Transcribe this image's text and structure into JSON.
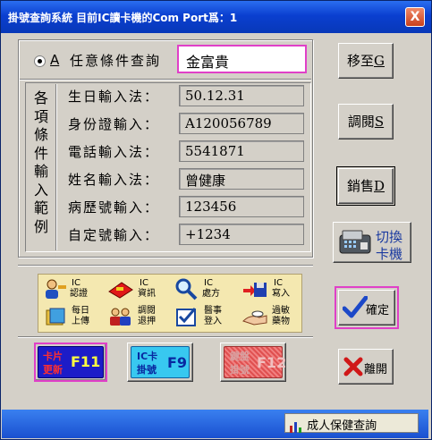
{
  "window": {
    "title": "掛號查詢系統 目前IC讀卡機的Com Port爲：1",
    "close_glyph": "X"
  },
  "search": {
    "radio_key": "A",
    "label": "任意條件查詢",
    "value": "金富貴"
  },
  "examples": {
    "vertical_label": [
      "各",
      "項",
      "條",
      "件",
      "輸",
      "入",
      "範",
      "例"
    ],
    "rows": [
      {
        "label": "生日輸入法：",
        "value": "50.12.31"
      },
      {
        "label": "身份證輸入：",
        "value": "A120056789"
      },
      {
        "label": "電話輸入法：",
        "value": "5541871"
      },
      {
        "label": "姓名輸入法：",
        "value": "曾健康"
      },
      {
        "label": "病歷號輸入：",
        "value": "123456"
      },
      {
        "label": "自定號輸入：",
        "value": "+1234"
      }
    ]
  },
  "side": {
    "move": {
      "text": "移至",
      "key": "G"
    },
    "review": {
      "text": "調閱",
      "key": "S"
    },
    "cancel": {
      "text": "銷售",
      "key": "D"
    },
    "switch_label_1": "切換",
    "switch_label_2": "卡機",
    "confirm": "確定",
    "leave": "離開"
  },
  "toolbar": {
    "row1": [
      {
        "line1": "IC",
        "line2": "認證",
        "icon": "person-key-icon"
      },
      {
        "line1": "IC",
        "line2": "資訊",
        "icon": "card-info-icon"
      },
      {
        "line1": "IC",
        "line2": "處方",
        "icon": "magnifier-icon"
      },
      {
        "line1": "IC",
        "line2": "寫入",
        "icon": "disk-write-icon"
      }
    ],
    "row2": [
      {
        "line1": "每日",
        "line2": "上傳",
        "icon": "book-upload-icon"
      },
      {
        "line1": "調閱",
        "line2": "退押",
        "icon": "people-icon"
      },
      {
        "line1": "醫事",
        "line2": "登入",
        "icon": "checklist-icon"
      },
      {
        "line1": "過敏",
        "line2": "藥物",
        "icon": "hand-pill-icon"
      }
    ]
  },
  "fkeys": [
    {
      "top": "卡片",
      "bottom": "更新",
      "key": "F11",
      "color": "#1c1cc8"
    },
    {
      "top": "IC卡",
      "bottom": "掛號",
      "key": "F9",
      "color": "#38c8f0"
    },
    {
      "top": "鍵盤",
      "bottom": "掛號",
      "key": "F12",
      "color": "#e05050"
    }
  ],
  "status": {
    "link": "成人保健查詢"
  },
  "colors": {
    "title_bar": "#0a3fd0",
    "accent_highlight": "#e040c8",
    "face": "#d4d0c8"
  }
}
